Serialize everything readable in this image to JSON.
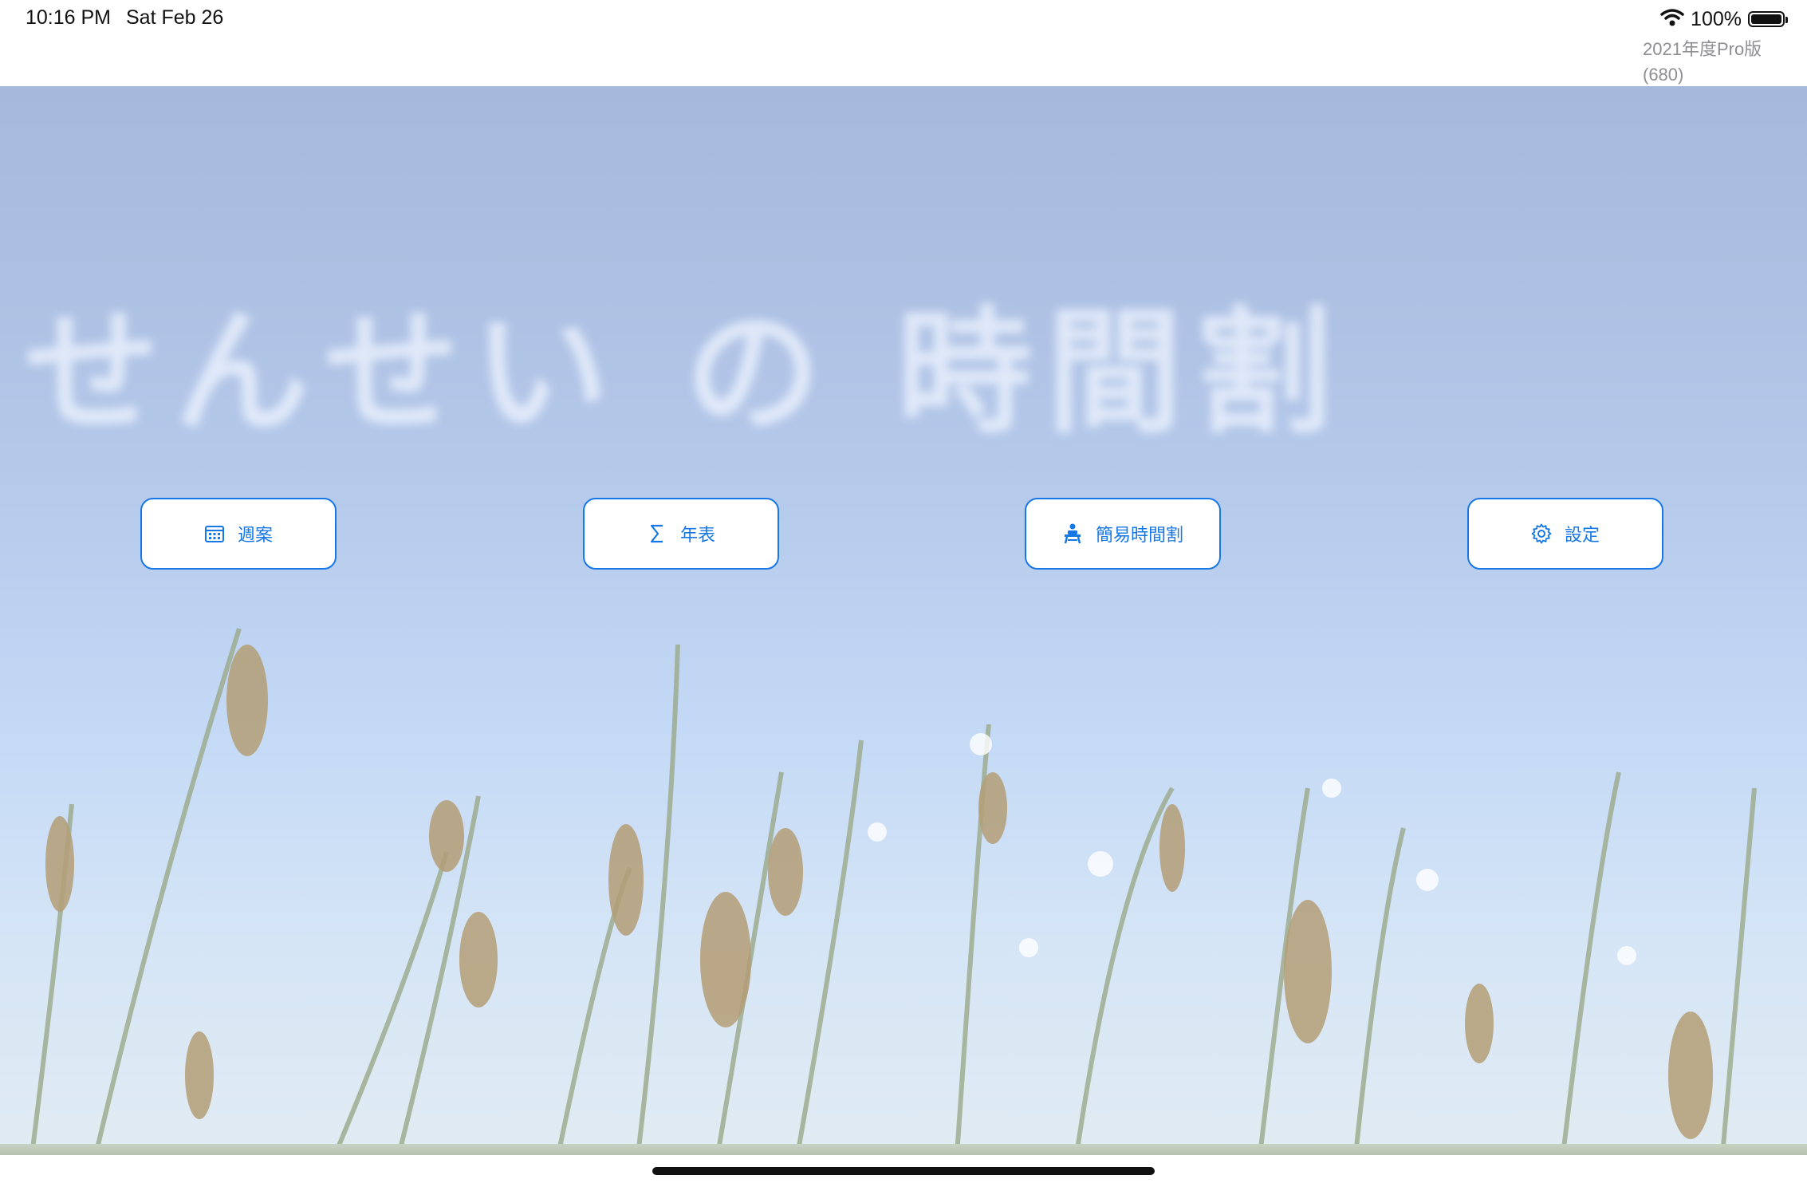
{
  "status_bar": {
    "time": "10:16 PM",
    "date": "Sat Feb 26",
    "battery": "100%"
  },
  "version": {
    "line1": "2021年度Pro版",
    "line2": "(680)"
  },
  "title": "せんせい の 時間割",
  "buttons": [
    {
      "label": "週案",
      "icon": "calendar-icon"
    },
    {
      "label": "年表",
      "icon": "sigma-icon"
    },
    {
      "label": "簡易時間割",
      "icon": "desk-icon"
    },
    {
      "label": "設定",
      "icon": "gear-icon"
    }
  ],
  "colors": {
    "accent": "#1677e6"
  }
}
